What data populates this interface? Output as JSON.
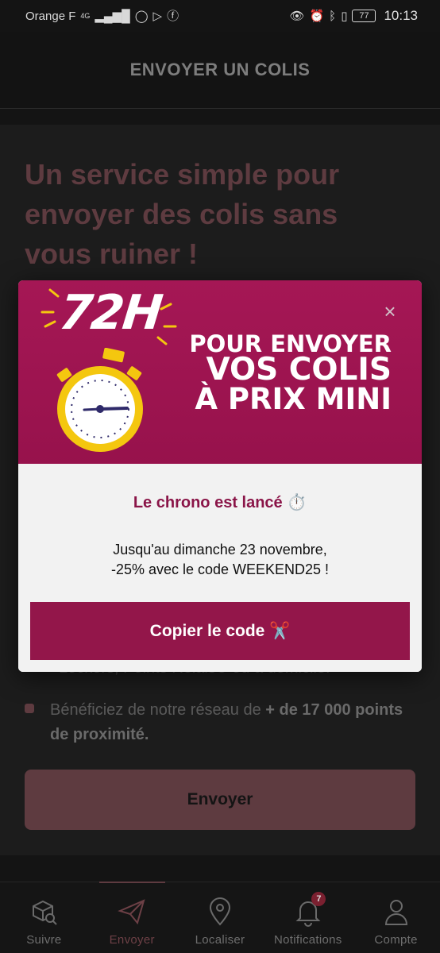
{
  "status_bar": {
    "carrier": "Orange F",
    "network": "4G",
    "battery": "77",
    "time": "10:13"
  },
  "header": {
    "title": "ENVOYER UN COLIS"
  },
  "main": {
    "hero_title": "Un service simple pour envoyer des colis sans vous ruiner !",
    "partial_feature": "Lockers, Points Relais® ou à domicile.",
    "feature_2_text": "Bénéficiez de notre réseau de ",
    "feature_2_bold": "+ de 17 000 points de proximité.",
    "send_button": "Envoyer"
  },
  "modal": {
    "badge": "72H",
    "banner_line1": "POUR ENVOYER",
    "banner_line2": "VOS COLIS",
    "banner_line3": "À PRIX MINI",
    "close_label": "×",
    "chrono_title": "Le chrono est lancé ⏱️",
    "promo_line1": "Jusqu'au dimanche 23 novembre,",
    "promo_line2": "-25% avec le code WEEKEND25 !",
    "copy_button": "Copier le code ✂️"
  },
  "bottom_nav": {
    "items": [
      {
        "label": "Suivre",
        "icon": "package-search-icon"
      },
      {
        "label": "Envoyer",
        "icon": "paper-plane-icon"
      },
      {
        "label": "Localiser",
        "icon": "map-pin-icon"
      },
      {
        "label": "Notifications",
        "icon": "bell-icon",
        "badge": "7"
      },
      {
        "label": "Compte",
        "icon": "user-icon"
      }
    ],
    "active": "Envoyer"
  },
  "colors": {
    "brand": "#93164a",
    "banner": "#a51755",
    "dim_accent": "#5e3b40"
  }
}
